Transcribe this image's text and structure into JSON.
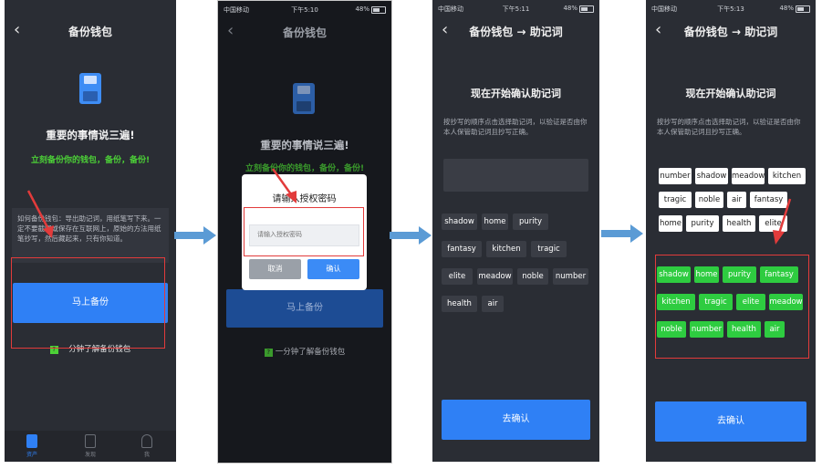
{
  "phone1": {
    "title": "备份钱包",
    "headline": "重要的事情说三遍!",
    "subline": "立刻备份你的钱包，备份，备份!",
    "notice": "如何备份钱包：导出助记词，用纸笔写下来。一定不要截图或保存在互联网上，原始的方法用纸笔抄写，然后藏起来，只有你知道。",
    "button": "马上备份",
    "link": "一分钟了解备份钱包",
    "tabs": [
      "资产",
      "发现",
      "我"
    ]
  },
  "phone2": {
    "status": {
      "carrier": "中国移动",
      "time": "下午5:10",
      "battery": "48%"
    },
    "title": "备份钱包",
    "headline": "重要的事情说三遍!",
    "subline": "立刻备份你的钱包，备份，备份!",
    "modal": {
      "title": "请输入授权密码",
      "placeholder": "请输入授权密码",
      "cancel": "取消",
      "confirm": "确认"
    },
    "button": "马上备份",
    "link": "一分钟了解备份钱包"
  },
  "phone3": {
    "status": {
      "carrier": "中国移动",
      "time": "下午5:11",
      "battery": "48%"
    },
    "title": "备份钱包 → 助记词",
    "heading": "现在开始确认助记词",
    "desc": "按抄写的顺序点击选择助记词，以验证是否由你本人保管助记词且抄写正确。",
    "words": [
      "shadow",
      "home",
      "purity",
      "fantasy",
      "kitchen",
      "tragic",
      "elite",
      "meadow",
      "noble",
      "number",
      "health",
      "air"
    ],
    "button": "去确认"
  },
  "phone4": {
    "status": {
      "carrier": "中国移动",
      "time": "下午5:13",
      "battery": "48%"
    },
    "title": "备份钱包 → 助记词",
    "heading": "现在开始确认助记词",
    "desc": "按抄写的顺序点击选择助记词，以验证是否由你本人保管助记词且抄写正确。",
    "selected": [
      "number",
      "shadow",
      "meadow",
      "kitchen",
      "tragic",
      "noble",
      "air",
      "fantasy",
      "home",
      "purity",
      "health",
      "elite"
    ],
    "words": [
      "shadow",
      "home",
      "purity",
      "fantasy",
      "kitchen",
      "tragic",
      "elite",
      "meadow",
      "noble",
      "number",
      "health",
      "air"
    ],
    "button": "去确认"
  },
  "colors": {
    "accent": "#2f80f5",
    "green": "#2ecc40",
    "annotation": "#e23b3b",
    "arrow": "#5b9bd5"
  }
}
